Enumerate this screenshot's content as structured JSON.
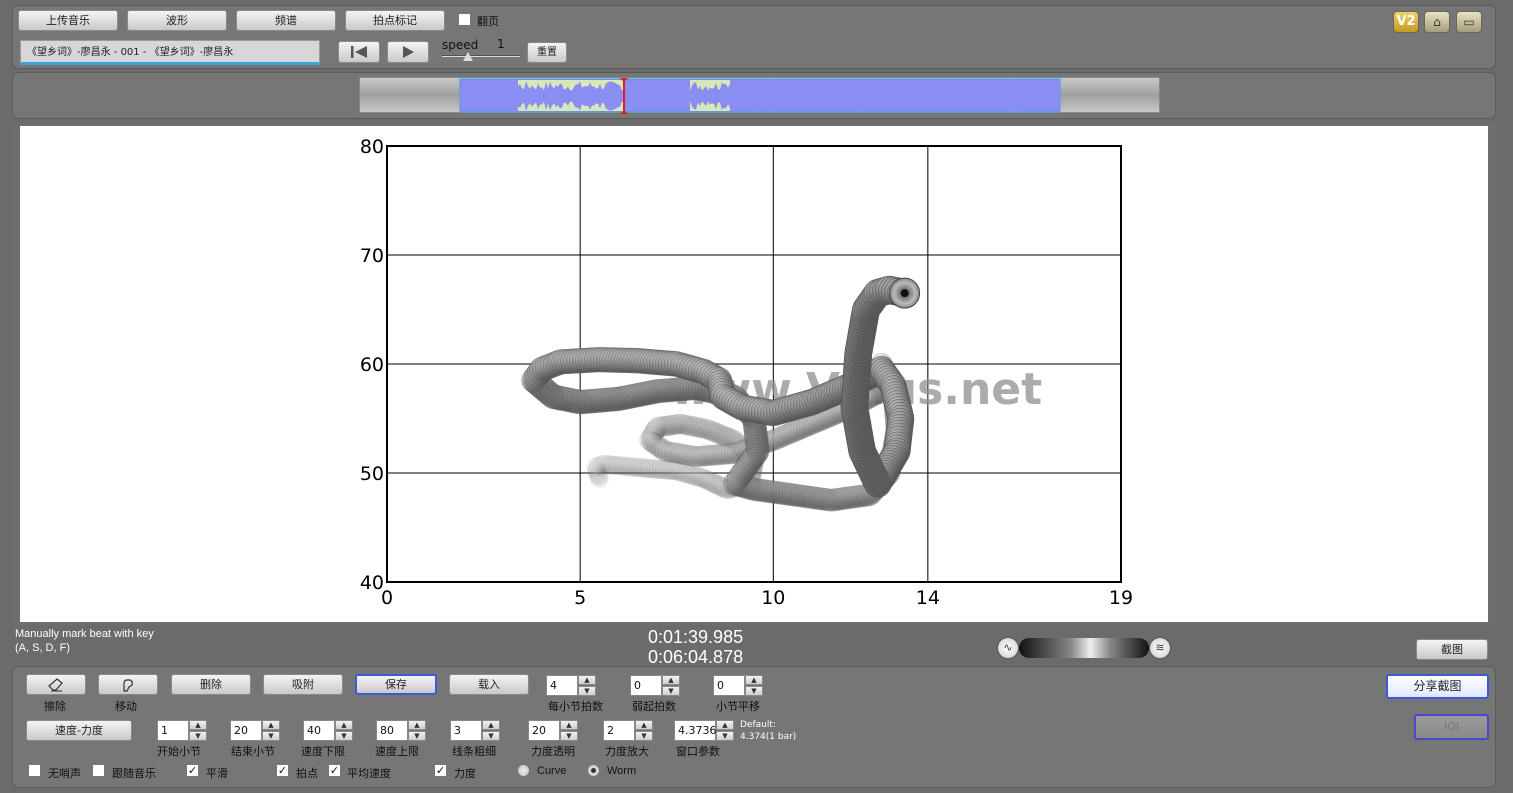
{
  "top_buttons": {
    "upload": "上传音乐",
    "waveform": "波形",
    "spectrum": "频谱",
    "beat_mark": "拍点标记"
  },
  "page_turn": {
    "label": "翻页",
    "checked": false
  },
  "track_title": "《望乡词》-廖昌永 - 001 - 《望乡词》-廖昌永",
  "speed": {
    "label": "speed",
    "value": "1"
  },
  "reset_label": "重置",
  "corner_badge": "V2",
  "chart_data": {
    "type": "scatter",
    "title": "",
    "xlabel": "",
    "ylabel": "",
    "xlim": [
      0,
      19
    ],
    "ylim": [
      40,
      80
    ],
    "x_ticks": [
      "0",
      "5",
      "10",
      "14",
      "19"
    ],
    "y_ticks": [
      "40",
      "50",
      "60",
      "70",
      "80"
    ],
    "grid": true,
    "style": "worm",
    "watermark": "www.Vmus.net",
    "series": [
      {
        "x": [
          5.5,
          5.4,
          5.6,
          6.2,
          6.8,
          7.5,
          8.2,
          8.8,
          9.4,
          9.5,
          9.0,
          8.3,
          7.6,
          7.0,
          6.8,
          7.2,
          8.0,
          9.0,
          10.0,
          11.0,
          12.0,
          12.8
        ],
        "y": [
          49.5,
          50.5,
          50.8,
          50.6,
          50.4,
          50.2,
          49.5,
          48.5,
          49.0,
          51.0,
          53.0,
          54.0,
          54.5,
          54.2,
          53.0,
          52.0,
          51.5,
          51.8,
          53.0,
          54.5,
          56.0,
          57.5
        ]
      },
      {
        "x": [
          12.8,
          13.1,
          13.2,
          13.0,
          12.5,
          11.5,
          10.5,
          9.5,
          9.0,
          9.2,
          9.6,
          9.5,
          9.0,
          8.0,
          7.0,
          6.0,
          5.0,
          4.3,
          3.8,
          4.0,
          4.5,
          5.5,
          6.5,
          7.5,
          8.2,
          8.6,
          8.7,
          9.2,
          10.0,
          11.0,
          12.0,
          12.8,
          13.1,
          13.3,
          13.2,
          12.7,
          12.3,
          12.1,
          12.2,
          12.4,
          12.7,
          13.0,
          13.4
        ],
        "y": [
          60.0,
          58.0,
          54.0,
          50.0,
          48.0,
          47.5,
          48.0,
          48.5,
          49.0,
          50.0,
          52.0,
          55.0,
          57.0,
          57.8,
          57.5,
          56.8,
          56.5,
          57.0,
          58.5,
          59.5,
          60.2,
          60.4,
          60.3,
          60.0,
          59.3,
          58.5,
          57.0,
          56.0,
          55.5,
          56.5,
          58.0,
          59.5,
          58.0,
          55.0,
          52.0,
          49.0,
          52.0,
          56.0,
          61.0,
          65.0,
          66.5,
          66.8,
          66.5
        ]
      }
    ]
  },
  "time_current": "0:01:39.985",
  "time_total": "0:06:04.878",
  "hint": {
    "line1": "Manually mark beat with key",
    "line2": "(A, S, D, F)"
  },
  "screenshot_label": "截图",
  "share_label": "分享截图",
  "ioi_label": "IOI",
  "tools": {
    "erase": "擦除",
    "move": "移动",
    "delete": "删除",
    "snap": "吸附",
    "save": "保存",
    "load": "载入",
    "tempo_dyn": "速度-力度"
  },
  "steppers_row1": [
    {
      "value": "4",
      "label": "每小节拍数"
    },
    {
      "value": "0",
      "label": "弱起拍数"
    },
    {
      "value": "0",
      "label": "小节平移"
    }
  ],
  "steppers_row2": [
    {
      "value": "1",
      "label": "开始小节"
    },
    {
      "value": "20",
      "label": "结束小节"
    },
    {
      "value": "40",
      "label": "速度下限"
    },
    {
      "value": "80",
      "label": "速度上限"
    },
    {
      "value": "3",
      "label": "线条粗细"
    },
    {
      "value": "20",
      "label": "力度透明"
    },
    {
      "value": "2",
      "label": "力度放大"
    },
    {
      "value": "4.3736",
      "label": "窗口参数"
    }
  ],
  "default_note": {
    "line1": "Default:",
    "line2": "4.374(1 bar)"
  },
  "options": [
    {
      "label": "无哨声",
      "checked": false
    },
    {
      "label": "跟随音乐",
      "checked": false
    },
    {
      "label": "平滑",
      "checked": true
    },
    {
      "label": "拍点",
      "checked": true
    },
    {
      "label": "平均速度",
      "checked": true
    },
    {
      "label": "力度",
      "checked": true
    }
  ],
  "render_mode": {
    "curve": "Curve",
    "worm": "Worm",
    "selected": "Worm"
  },
  "colors": {
    "waveform": "#8a8ef2",
    "waveform_bg": "#d8e6b8",
    "playhead": "#e02020",
    "accent": "#3a5ad8"
  }
}
